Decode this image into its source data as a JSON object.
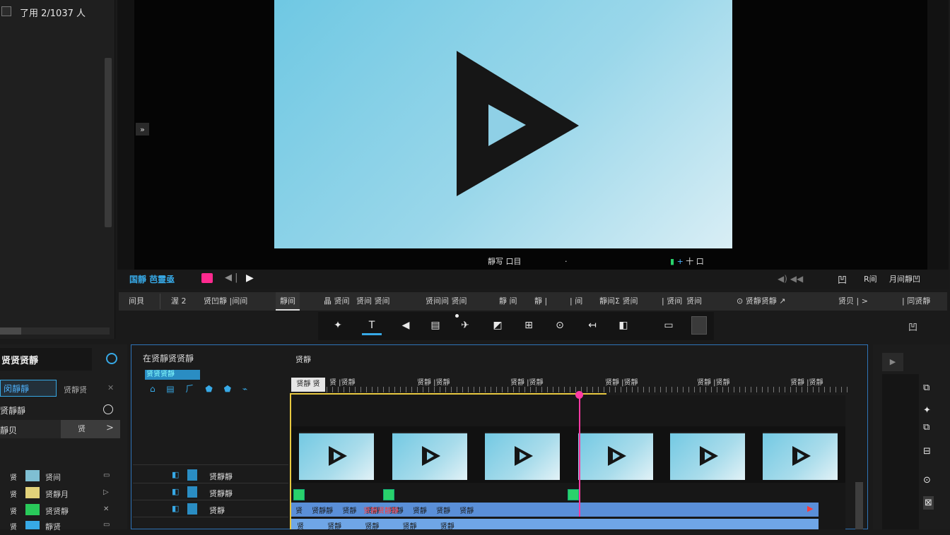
{
  "media_panel": {
    "title": "了用 2/1037 人"
  },
  "viewer": {
    "collapse_icon": "»",
    "info_left": "靜写 口目",
    "info_mid": "·",
    "info_right_g": "▮",
    "info_right_b": "+",
    "info_right_text": "十 口"
  },
  "transport": {
    "label": "国靜 芭靈亟",
    "nav": "◀ |",
    "play": "▶",
    "volume": "◀) ◀◀",
    "r1": "凹",
    "r2": "R间",
    "r3": "月间靜凹"
  },
  "menu": {
    "items": [
      "间貝",
      "渥  2",
      "贤凹靜 |间间",
      "靜间",
      "晶  贤间",
      "贤间  贤间",
      "贤间间  贤间",
      "靜  间",
      "靜  |",
      "|  间",
      "靜间Ʃ  贤间",
      "|  贤间",
      "贤间",
      "⊙ 贤靜贤靜  ↗",
      "贤贝  |  >",
      "|  同贤靜"
    ]
  },
  "tools": {
    "icons": [
      "✦",
      "T",
      "◀",
      "▤",
      "✈",
      "◩",
      "⊞",
      "⊙",
      "↤",
      "◧",
      "▭"
    ],
    "right": "凹"
  },
  "effects_panel": {
    "title": "贤贤贤靜",
    "tab_active": "闵靜靜",
    "tab_other": "贤靜贤",
    "tab_close": "✕",
    "row1": "贤靜靜",
    "row2": "靜贝",
    "row2_btn": "贤",
    "row2_chev": ">",
    "items": [
      {
        "mark": "贤",
        "label": "贤间",
        "end": "▭",
        "color": "#7fbfd3"
      },
      {
        "mark": "贤",
        "label": "贤靜月",
        "end": "▷",
        "color": "#e2d27a"
      },
      {
        "mark": "贤",
        "label": "贤贤靜",
        "end": "✕",
        "color": "#29c95a"
      },
      {
        "mark": "贤",
        "label": "靜贤",
        "end": "▭",
        "color": "#37a9e6"
      }
    ]
  },
  "timeline": {
    "title": "在贤靜贤贤靜",
    "subtitle": "贤靜",
    "tag": "贤贤贤靜",
    "tools": "⌂ ▤ ⺁ ⬟ ⬟ ⌁",
    "timecode": "贤靜 贤",
    "ruler": [
      "贤 |贤靜",
      "贤靜 |贤靜",
      "贤靜 |贤靜",
      "贤靜 |贤靜",
      "贤靜 |贤靜",
      "贤靜 |贤靜"
    ],
    "track_labels": [
      "贤靜靜",
      "贤靜靜",
      "贤靜"
    ],
    "audio1": "贤 贤靜靜 贤靜 贤靜 贤靜 贤靜 贤靜 贤靜",
    "audio1_red": "贤靜贤靜靜",
    "audio2": "贤 贤靜 贤靜 贤靜 贤靜"
  },
  "right_panel": {
    "top": "▶",
    "icons": [
      "⧉",
      "✦",
      "⧉",
      "⊟",
      "⊙",
      "⊠"
    ]
  },
  "colors": {
    "accent": "#37a9e6",
    "playhead": "#ff3aa3",
    "in_out": "#e8c840",
    "keyframe": "#29d26b",
    "audio_clip": "#5a8fd8"
  }
}
